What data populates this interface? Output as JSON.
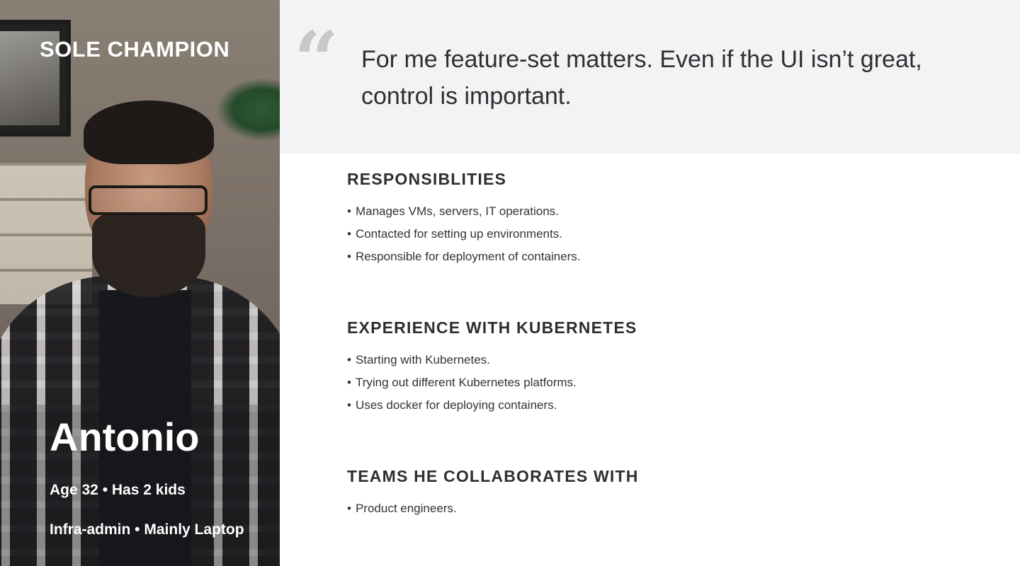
{
  "persona": {
    "role": "SOLE CHAMPION",
    "name": "Antonio",
    "meta_line_1": "Age 32 • Has 2 kids",
    "meta_line_2": "Infra-admin • Mainly Laptop"
  },
  "quote": {
    "mark": "“",
    "text": "For me feature-set matters. Even if the UI isn’t great, control is important."
  },
  "sections": [
    {
      "heading": "RESPONSIBLITIES",
      "items": [
        "Manages VMs, servers, IT operations.",
        "Contacted for setting up environments.",
        "Responsible for deployment of containers."
      ]
    },
    {
      "heading": "EXPERIENCE WITH KUBERNETES",
      "items": [
        "Starting with Kubernetes.",
        "Trying out different Kubernetes platforms.",
        "Uses docker for deploying containers."
      ]
    },
    {
      "heading": "TEAMS HE COLLABORATES WITH",
      "items": [
        "Product engineers."
      ]
    }
  ],
  "bullet": "•",
  "colors": {
    "banner_bg": "#f3f3f5",
    "text": "#2f2f33",
    "quote_mark": "#c8c8ca"
  }
}
